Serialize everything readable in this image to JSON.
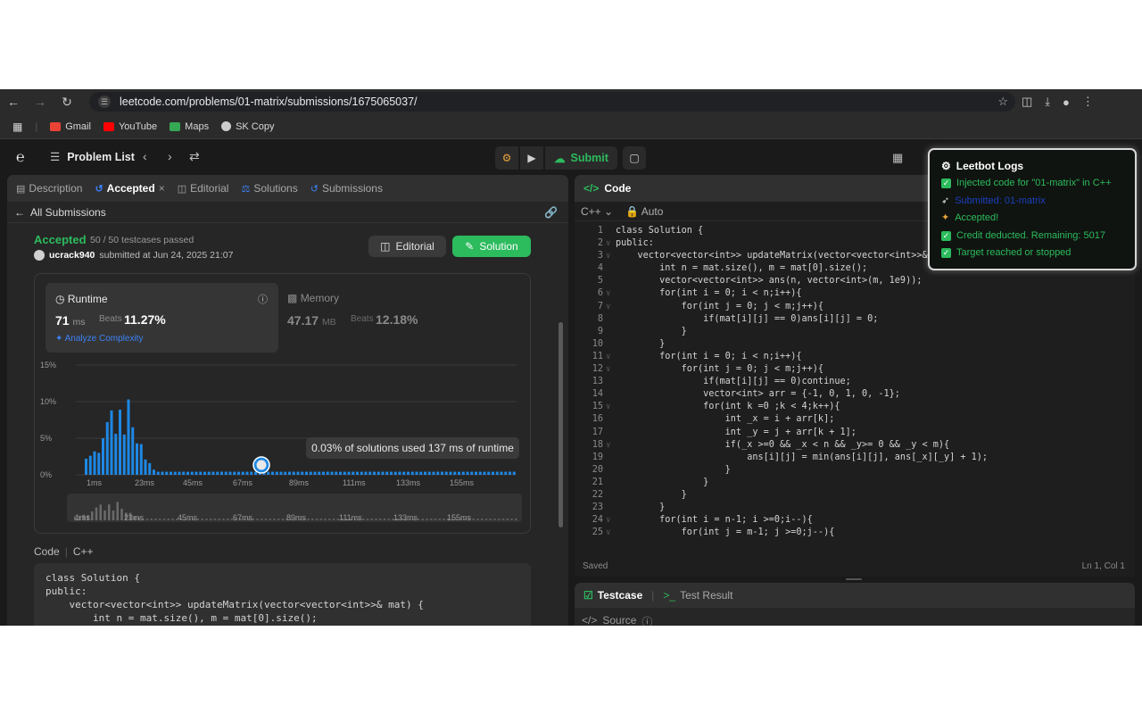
{
  "browser": {
    "url": "leetcode.com/problems/01-matrix/submissions/1675065037/",
    "bookmarks": [
      {
        "label": "Gmail",
        "color": "#ea4335"
      },
      {
        "label": "YouTube",
        "color": "#ff0000"
      },
      {
        "label": "Maps",
        "color": "#34a853"
      },
      {
        "label": "SK Copy",
        "color": "#cccccc"
      }
    ]
  },
  "nav": {
    "problem_list": "Problem List",
    "submit": "Submit"
  },
  "left": {
    "tabs": {
      "description": "Description",
      "accepted": "Accepted",
      "editorial": "Editorial",
      "solutions": "Solutions",
      "submissions": "Submissions"
    },
    "all_submissions": "All Submissions",
    "status": "Accepted",
    "testcases": "50 / 50 testcases passed",
    "user": "ucrack940",
    "submitted_at": "submitted at Jun 24, 2025 21:07",
    "editorial_btn": "Editorial",
    "solution_btn": "Solution",
    "runtime": {
      "title": "Runtime",
      "value": "71",
      "unit": "ms",
      "beats_label": "Beats",
      "beats": "11.27%",
      "analyze": "Analyze Complexity"
    },
    "memory": {
      "title": "Memory",
      "value": "47.17",
      "unit": "MB",
      "beats_label": "Beats",
      "beats": "12.18%"
    },
    "tooltip": "0.03% of solutions used 137 ms of runtime",
    "code_label": "Code",
    "code_lang": "C++"
  },
  "chart_data": {
    "type": "bar",
    "y_ticks": [
      "15%",
      "10%",
      "5%",
      "0%"
    ],
    "ylim": [
      0,
      15
    ],
    "x_ticks": [
      "1ms",
      "23ms",
      "45ms",
      "67ms",
      "89ms",
      "111ms",
      "133ms",
      "155ms"
    ],
    "values": [
      2.2,
      2.6,
      3.2,
      3.0,
      5.0,
      7.2,
      8.8,
      5.6,
      8.9,
      5.5,
      10.3,
      6.5,
      4.3,
      4.2,
      2.1,
      1.6,
      0.7
    ],
    "tail_value": 0.3,
    "tail_count": 100,
    "mini_ticks": [
      "1ms",
      "23ms",
      "45ms",
      "67ms",
      "89ms",
      "111ms",
      "133ms",
      "155ms"
    ],
    "colors": {
      "bar": "#1e88e5",
      "highlight": "#ffffff"
    }
  },
  "right": {
    "title": "Code",
    "lang": "C++",
    "auto": "Auto",
    "code_lines": [
      {
        "n": "1",
        "t": "class Solution {"
      },
      {
        "n": "2",
        "t": "public:"
      },
      {
        "n": "3",
        "t": "    vector<vector<int>> updateMatrix(vector<vector<int>>& mat) {"
      },
      {
        "n": "4",
        "t": "        int n = mat.size(), m = mat[0].size();"
      },
      {
        "n": "5",
        "t": "        vector<vector<int>> ans(n, vector<int>(m, 1e9));"
      },
      {
        "n": "6",
        "t": "        for(int i = 0; i < n;i++){"
      },
      {
        "n": "7",
        "t": "            for(int j = 0; j < m;j++){"
      },
      {
        "n": "8",
        "t": "                if(mat[i][j] == 0)ans[i][j] = 0;"
      },
      {
        "n": "9",
        "t": "            }"
      },
      {
        "n": "10",
        "t": "        }"
      },
      {
        "n": "11",
        "t": "        for(int i = 0; i < n;i++){"
      },
      {
        "n": "12",
        "t": "            for(int j = 0; j < m;j++){"
      },
      {
        "n": "13",
        "t": "                if(mat[i][j] == 0)continue;"
      },
      {
        "n": "14",
        "t": "                vector<int> arr = {-1, 0, 1, 0, -1};"
      },
      {
        "n": "15",
        "t": "                for(int k =0 ;k < 4;k++){"
      },
      {
        "n": "16",
        "t": "                    int _x = i + arr[k];"
      },
      {
        "n": "17",
        "t": "                    int _y = j + arr[k + 1];"
      },
      {
        "n": "18",
        "t": "                    if(_x >=0 && _x < n && _y>= 0 && _y < m){"
      },
      {
        "n": "19",
        "t": "                        ans[i][j] = min(ans[i][j], ans[_x][_y] + 1);"
      },
      {
        "n": "20",
        "t": "                    }"
      },
      {
        "n": "21",
        "t": "                }"
      },
      {
        "n": "22",
        "t": "            }"
      },
      {
        "n": "23",
        "t": "        }"
      },
      {
        "n": "24",
        "t": "        for(int i = n-1; i >=0;i--){"
      },
      {
        "n": "25",
        "t": "            for(int j = m-1; j >=0;j--){"
      }
    ],
    "saved": "Saved",
    "cursor": "Ln 1, Col 1",
    "testcase_tab": "Testcase",
    "result_tab": "Test Result",
    "source": "Source"
  },
  "leetbot": {
    "title": "Leetbot Logs",
    "logs": [
      {
        "text": "Injected code for \"01-matrix\" in C++",
        "color": "#2cbb5d",
        "icon": "check-icon"
      },
      {
        "text": "Submitted: 01-matrix",
        "color": "#1a3fbf",
        "icon": "rocket-icon"
      },
      {
        "text": "Accepted!",
        "color": "#2cbb5d",
        "icon": "party-icon"
      },
      {
        "text": "Credit deducted. Remaining: 5017",
        "color": "#2cbb5d",
        "icon": "check-icon"
      },
      {
        "text": "Target reached or stopped",
        "color": "#2cbb5d",
        "icon": "check-icon"
      }
    ]
  }
}
